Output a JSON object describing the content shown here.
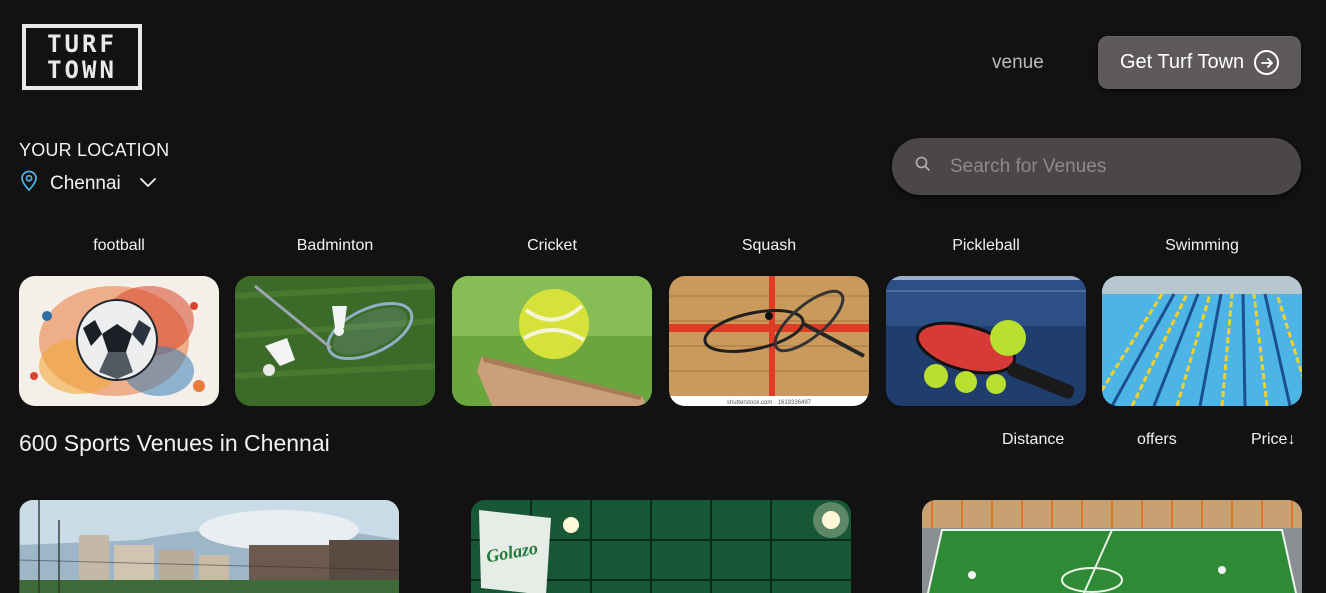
{
  "logo": {
    "line1": "TURF",
    "line2": "TOWN"
  },
  "header": {
    "nav_venue": "venue",
    "cta_label": "Get Turf Town"
  },
  "location": {
    "label": "YOUR LOCATION",
    "city": "Chennai"
  },
  "search": {
    "placeholder": "Search for Venues"
  },
  "sports": [
    {
      "label": "football",
      "image": "soccer ball watercolor splash"
    },
    {
      "label": "Badminton",
      "image": "badminton racket and shuttlecocks on grass"
    },
    {
      "label": "Cricket",
      "image": "cricket ball on bat on grass"
    },
    {
      "label": "Squash",
      "image": "squash rackets on wooden court"
    },
    {
      "label": "Pickleball",
      "image": "pickleball paddle and balls"
    },
    {
      "label": "Swimming",
      "image": "swimming pool lanes"
    }
  ],
  "squash_watermark": "shutterstock.com · 1619336497",
  "results": {
    "title": "600 Sports Venues in Chennai",
    "sort_options": [
      "Distance",
      "offers",
      "Price↓"
    ]
  },
  "venues": [
    {
      "image": "turf with netting and buildings"
    },
    {
      "image": "indoor green court with Golazo sign",
      "sign": "Golazo"
    },
    {
      "image": "aerial view of green football turf"
    }
  ],
  "colors": {
    "background": "#121212",
    "button": "#5e5a59",
    "search_bg": "#4b4747",
    "accent_pin": "#4fb3e8"
  },
  "icons": {
    "cta": "arrow-right-circle-icon",
    "location": "map-pin-icon",
    "dropdown": "chevron-down-icon",
    "search": "search-icon"
  }
}
